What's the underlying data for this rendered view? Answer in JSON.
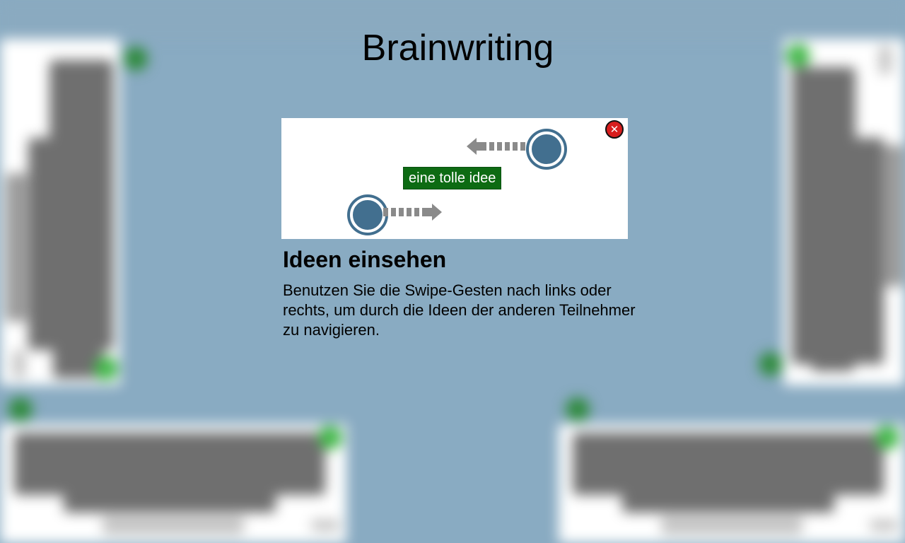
{
  "app": {
    "title": "Brainwriting"
  },
  "tutorial": {
    "close_icon": "close-icon",
    "close_glyph": "✕",
    "demo_idea_text": "eine tolle idee",
    "heading": "Ideen einsehen",
    "description": "Benutzen Sie die Swipe-Gesten nach links oder rechts, um durch die Ideen der anderen Teilnehmer zu navigieren."
  },
  "colors": {
    "background": "#89abc2",
    "swipe_circle": "#426f8f",
    "idea_label_bg": "#0d6b13",
    "close_button": "#d81e1e",
    "participant_indicator": "#43b84a"
  }
}
